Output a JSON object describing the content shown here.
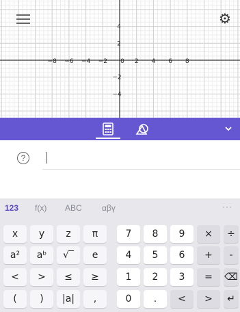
{
  "graph": {
    "x_ticks": [
      "−8",
      "−6",
      "−4",
      "−2",
      "0",
      "2",
      "4",
      "6",
      "8"
    ],
    "y_ticks_positive": [
      "4",
      "2"
    ],
    "y_ticks_negative": [
      "−2",
      "−4"
    ]
  },
  "icons": {
    "menu": "hamburger-menu-icon",
    "settings": "gear-icon",
    "algebra_tab": "calculator-icon",
    "tools_tab": "geometry-tools-icon",
    "collapse": "chevron-down-icon",
    "help": "question-mark-icon"
  },
  "algebra": {
    "help_glyph": "?"
  },
  "keyboard": {
    "tabs": [
      {
        "label": "123",
        "active": true
      },
      {
        "label": "f(x)",
        "active": false
      },
      {
        "label": "ABC",
        "active": false
      },
      {
        "label": "αβγ",
        "active": false
      }
    ],
    "more": "···",
    "rows": [
      [
        "x",
        "y",
        "z",
        "π",
        "7",
        "8",
        "9",
        "×",
        "÷"
      ],
      [
        "a²",
        "aᵇ",
        "√‾",
        "e",
        "4",
        "5",
        "6",
        "+",
        "-"
      ],
      [
        "<",
        ">",
        "≤",
        "≥",
        "1",
        "2",
        "3",
        "=",
        "⌫"
      ],
      [
        "(",
        ")",
        "|a|",
        ",",
        "0",
        ".",
        "<",
        ">",
        "↵"
      ]
    ]
  },
  "colors": {
    "toolbar": "#6557d2",
    "active_tab": "#5b4cc4",
    "keyboard_bg": "#e7e7ec"
  }
}
